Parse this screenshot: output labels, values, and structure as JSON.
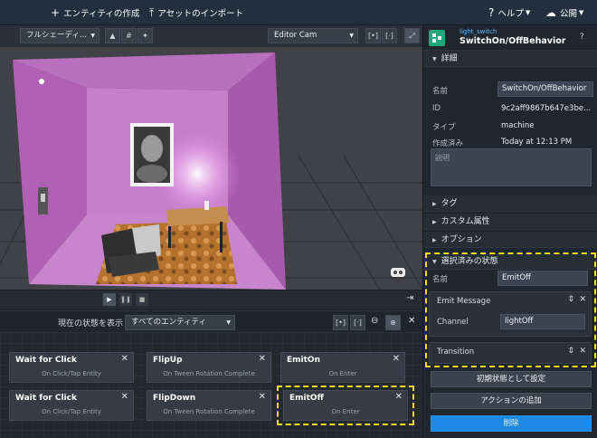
{
  "topbar": {
    "create_entity": "エンティティの作成",
    "import_asset": "アセットのインポート",
    "help": "ヘルプ",
    "publish": "公開"
  },
  "viewport_toolbar": {
    "shading_mode": "フルシェーディ...",
    "camera": "Editor Cam"
  },
  "state_toolbar": {
    "show_states_label": "現在の状態を表示",
    "entity_filter": "すべてのエンティティ"
  },
  "nodes": [
    {
      "title": "Wait for Click",
      "event": "On Click/Tap Entity"
    },
    {
      "title": "FlipUp",
      "event": "On Tween Rotation Complete"
    },
    {
      "title": "EmitOn",
      "event": "On Enter"
    },
    {
      "title": "Wait for Click",
      "event": "On Click/Tap Entity"
    },
    {
      "title": "FlipDown",
      "event": "On Tween Rotation Complete"
    },
    {
      "title": "EmitOff",
      "event": "On Enter"
    }
  ],
  "panel": {
    "subtitle": "light_switch",
    "title": "SwitchOn/OffBehavior",
    "details_header": "詳細",
    "name_label": "名前",
    "name_value": "SwitchOn/OffBehavior",
    "id_label": "ID",
    "id_value": "9c2aff9867b647e3be...",
    "type_label": "タイプ",
    "type_value": "machine",
    "created_label": "作成済み",
    "created_value": "Today at 12:13 PM",
    "description_placeholder": "説明",
    "tags_header": "タグ",
    "custom_attrs_header": "カスタム属性",
    "options_header": "オプション",
    "selected_state_header": "選択済みの状態",
    "state_name_label": "名前",
    "state_name_value": "EmitOff",
    "emit_message_title": "Emit Message",
    "channel_label": "Channel",
    "channel_value": "lightOff",
    "transition_title": "Transition",
    "set_initial_button": "初期状態として設定",
    "add_action_button": "アクションの追加",
    "delete_button": "削除"
  },
  "colors": {
    "accent": "#1e88e5",
    "highlight": "#f2e200",
    "brand_logo": "#1fa87a"
  }
}
